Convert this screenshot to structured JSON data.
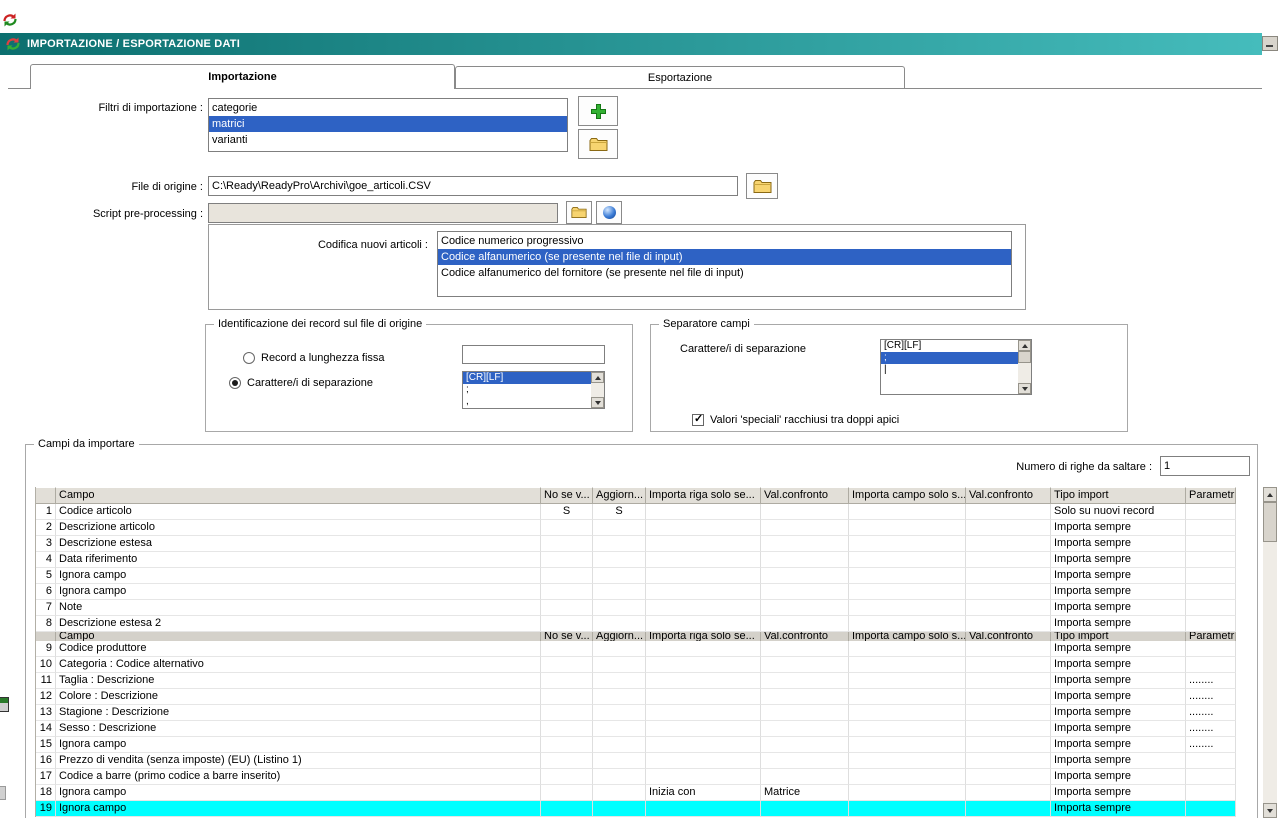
{
  "titlebar": {
    "title": "IMPORTAZIONE / ESPORTAZIONE DATI"
  },
  "tabs": {
    "import": "Importazione",
    "export": "Esportazione"
  },
  "import_filters": {
    "label": "Filtri di importazione :",
    "items": [
      {
        "label": "categorie",
        "selected": false
      },
      {
        "label": "matrici",
        "selected": true
      },
      {
        "label": "varianti",
        "selected": false
      }
    ]
  },
  "source_file": {
    "label": "File di origine :",
    "value": "C:\\Ready\\ReadyPro\\Archivi\\goe_articoli.CSV"
  },
  "preprocess": {
    "label": "Script pre-processing :",
    "value": ""
  },
  "coding": {
    "label": "Codifica nuovi articoli :",
    "options": [
      {
        "label": "Codice numerico progressivo",
        "selected": false
      },
      {
        "label": "Codice alfanumerico (se presente nel file di input)",
        "selected": true
      },
      {
        "label": "Codice alfanumerico del fornitore (se presente nel file di input)",
        "selected": false
      }
    ]
  },
  "record_group": {
    "title": "Identificazione dei record sul file di origine",
    "fixed_length_label": "Record a lunghezza fissa",
    "fixed_length_value": "",
    "separator_label": "Carattere/i di separazione",
    "separators": [
      {
        "label": "[CR][LF]",
        "selected": true
      },
      {
        "label": ";",
        "selected": false
      },
      {
        "label": ",",
        "selected": false
      }
    ]
  },
  "separator_group": {
    "title": "Separatore campi",
    "label": "Carattere/i di separazione",
    "separators": [
      {
        "label": "[CR][LF]",
        "selected": false
      },
      {
        "label": ";",
        "selected": true
      },
      {
        "label": "|",
        "selected": false
      }
    ],
    "quotes_checkbox": "Valori 'speciali' racchiusi tra doppi apici",
    "quotes_checked": true
  },
  "fields_group": {
    "title": "Campi da importare",
    "skip_label": "Numero di righe da saltare :",
    "skip_value": "1",
    "table": {
      "headers": [
        "",
        "Campo",
        "No se v...",
        "Aggiorn...",
        "Importa riga solo se...",
        "Val.confronto",
        "Importa campo solo s...",
        "Val.confronto",
        "Tipo import",
        "Parametri"
      ],
      "rows": [
        [
          "1",
          "Codice articolo",
          "S",
          "S",
          "",
          "",
          "",
          "",
          "Solo su nuovi record",
          ""
        ],
        [
          "2",
          "Descrizione articolo",
          "",
          "",
          "",
          "",
          "",
          "",
          "Importa sempre",
          ""
        ],
        [
          "3",
          "Descrizione estesa",
          "",
          "",
          "",
          "",
          "",
          "",
          "Importa sempre",
          ""
        ],
        [
          "4",
          "Data riferimento",
          "",
          "",
          "",
          "",
          "",
          "",
          "Importa sempre",
          ""
        ],
        [
          "5",
          "Ignora campo",
          "",
          "",
          "",
          "",
          "",
          "",
          "Importa sempre",
          ""
        ],
        [
          "6",
          "Ignora campo",
          "",
          "",
          "",
          "",
          "",
          "",
          "Importa sempre",
          ""
        ],
        [
          "7",
          "Note",
          "",
          "",
          "",
          "",
          "",
          "",
          "Importa sempre",
          ""
        ],
        [
          "8",
          "Descrizione estesa 2",
          "",
          "",
          "",
          "",
          "",
          "",
          "Importa sempre",
          ""
        ],
        [
          "9",
          "Codice produttore",
          "",
          "",
          "",
          "",
          "",
          "",
          "Importa sempre",
          ""
        ],
        [
          "10",
          "Categoria : Codice alternativo",
          "",
          "",
          "",
          "",
          "",
          "",
          "Importa sempre",
          ""
        ],
        [
          "11",
          "Taglia : Descrizione",
          "",
          "",
          "",
          "",
          "",
          "",
          "Importa sempre",
          "........"
        ],
        [
          "12",
          "Colore : Descrizione",
          "",
          "",
          "",
          "",
          "",
          "",
          "Importa sempre",
          "........"
        ],
        [
          "13",
          "Stagione : Descrizione",
          "",
          "",
          "",
          "",
          "",
          "",
          "Importa sempre",
          "........"
        ],
        [
          "14",
          "Sesso : Descrizione",
          "",
          "",
          "",
          "",
          "",
          "",
          "Importa sempre",
          "........"
        ],
        [
          "15",
          "Ignora campo",
          "",
          "",
          "",
          "",
          "",
          "",
          "Importa sempre",
          "........"
        ],
        [
          "16",
          "Prezzo di vendita (senza imposte) (EU) (Listino 1)",
          "",
          "",
          "",
          "",
          "",
          "",
          "Importa sempre",
          ""
        ],
        [
          "17",
          "Codice a barre (primo codice a barre inserito)",
          "",
          "",
          "",
          "",
          "",
          "",
          "Importa sempre",
          ""
        ],
        [
          "18",
          "Ignora campo",
          "",
          "",
          "Inizia con",
          "Matrice",
          "",
          "",
          "Importa sempre",
          ""
        ],
        [
          "19",
          "Ignora campo",
          "",
          "",
          "",
          "",
          "",
          "",
          "Importa sempre",
          ""
        ]
      ],
      "highlighted_row": 19,
      "glitch_after_row": 8
    }
  },
  "colors": {
    "selection": "#2e62c4",
    "highlight_row": "#00ffff",
    "titlebar_start": "#0c6f6f",
    "titlebar_end": "#45bcbc"
  }
}
